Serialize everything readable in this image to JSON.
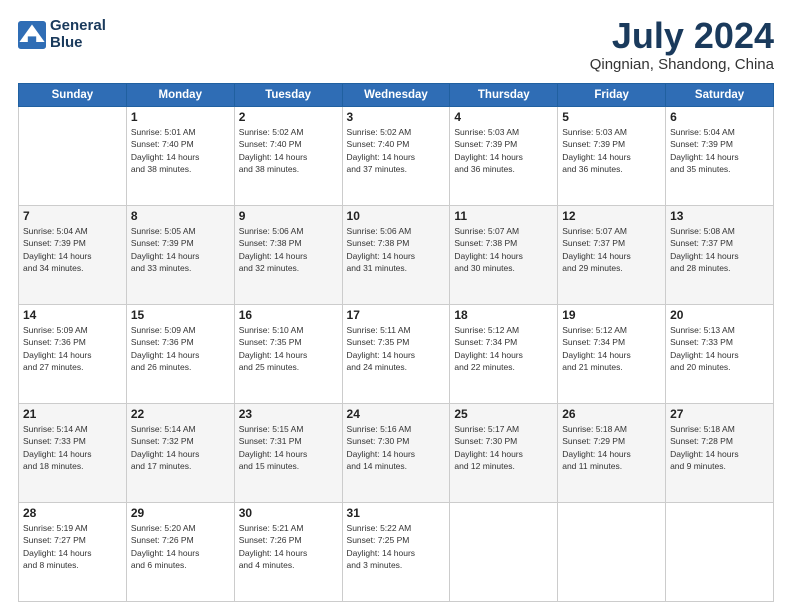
{
  "header": {
    "logo_line1": "General",
    "logo_line2": "Blue",
    "month": "July 2024",
    "location": "Qingnian, Shandong, China"
  },
  "weekdays": [
    "Sunday",
    "Monday",
    "Tuesday",
    "Wednesday",
    "Thursday",
    "Friday",
    "Saturday"
  ],
  "weeks": [
    [
      {
        "day": "",
        "info": ""
      },
      {
        "day": "1",
        "info": "Sunrise: 5:01 AM\nSunset: 7:40 PM\nDaylight: 14 hours\nand 38 minutes."
      },
      {
        "day": "2",
        "info": "Sunrise: 5:02 AM\nSunset: 7:40 PM\nDaylight: 14 hours\nand 38 minutes."
      },
      {
        "day": "3",
        "info": "Sunrise: 5:02 AM\nSunset: 7:40 PM\nDaylight: 14 hours\nand 37 minutes."
      },
      {
        "day": "4",
        "info": "Sunrise: 5:03 AM\nSunset: 7:39 PM\nDaylight: 14 hours\nand 36 minutes."
      },
      {
        "day": "5",
        "info": "Sunrise: 5:03 AM\nSunset: 7:39 PM\nDaylight: 14 hours\nand 36 minutes."
      },
      {
        "day": "6",
        "info": "Sunrise: 5:04 AM\nSunset: 7:39 PM\nDaylight: 14 hours\nand 35 minutes."
      }
    ],
    [
      {
        "day": "7",
        "info": "Sunrise: 5:04 AM\nSunset: 7:39 PM\nDaylight: 14 hours\nand 34 minutes."
      },
      {
        "day": "8",
        "info": "Sunrise: 5:05 AM\nSunset: 7:39 PM\nDaylight: 14 hours\nand 33 minutes."
      },
      {
        "day": "9",
        "info": "Sunrise: 5:06 AM\nSunset: 7:38 PM\nDaylight: 14 hours\nand 32 minutes."
      },
      {
        "day": "10",
        "info": "Sunrise: 5:06 AM\nSunset: 7:38 PM\nDaylight: 14 hours\nand 31 minutes."
      },
      {
        "day": "11",
        "info": "Sunrise: 5:07 AM\nSunset: 7:38 PM\nDaylight: 14 hours\nand 30 minutes."
      },
      {
        "day": "12",
        "info": "Sunrise: 5:07 AM\nSunset: 7:37 PM\nDaylight: 14 hours\nand 29 minutes."
      },
      {
        "day": "13",
        "info": "Sunrise: 5:08 AM\nSunset: 7:37 PM\nDaylight: 14 hours\nand 28 minutes."
      }
    ],
    [
      {
        "day": "14",
        "info": "Sunrise: 5:09 AM\nSunset: 7:36 PM\nDaylight: 14 hours\nand 27 minutes."
      },
      {
        "day": "15",
        "info": "Sunrise: 5:09 AM\nSunset: 7:36 PM\nDaylight: 14 hours\nand 26 minutes."
      },
      {
        "day": "16",
        "info": "Sunrise: 5:10 AM\nSunset: 7:35 PM\nDaylight: 14 hours\nand 25 minutes."
      },
      {
        "day": "17",
        "info": "Sunrise: 5:11 AM\nSunset: 7:35 PM\nDaylight: 14 hours\nand 24 minutes."
      },
      {
        "day": "18",
        "info": "Sunrise: 5:12 AM\nSunset: 7:34 PM\nDaylight: 14 hours\nand 22 minutes."
      },
      {
        "day": "19",
        "info": "Sunrise: 5:12 AM\nSunset: 7:34 PM\nDaylight: 14 hours\nand 21 minutes."
      },
      {
        "day": "20",
        "info": "Sunrise: 5:13 AM\nSunset: 7:33 PM\nDaylight: 14 hours\nand 20 minutes."
      }
    ],
    [
      {
        "day": "21",
        "info": "Sunrise: 5:14 AM\nSunset: 7:33 PM\nDaylight: 14 hours\nand 18 minutes."
      },
      {
        "day": "22",
        "info": "Sunrise: 5:14 AM\nSunset: 7:32 PM\nDaylight: 14 hours\nand 17 minutes."
      },
      {
        "day": "23",
        "info": "Sunrise: 5:15 AM\nSunset: 7:31 PM\nDaylight: 14 hours\nand 15 minutes."
      },
      {
        "day": "24",
        "info": "Sunrise: 5:16 AM\nSunset: 7:30 PM\nDaylight: 14 hours\nand 14 minutes."
      },
      {
        "day": "25",
        "info": "Sunrise: 5:17 AM\nSunset: 7:30 PM\nDaylight: 14 hours\nand 12 minutes."
      },
      {
        "day": "26",
        "info": "Sunrise: 5:18 AM\nSunset: 7:29 PM\nDaylight: 14 hours\nand 11 minutes."
      },
      {
        "day": "27",
        "info": "Sunrise: 5:18 AM\nSunset: 7:28 PM\nDaylight: 14 hours\nand 9 minutes."
      }
    ],
    [
      {
        "day": "28",
        "info": "Sunrise: 5:19 AM\nSunset: 7:27 PM\nDaylight: 14 hours\nand 8 minutes."
      },
      {
        "day": "29",
        "info": "Sunrise: 5:20 AM\nSunset: 7:26 PM\nDaylight: 14 hours\nand 6 minutes."
      },
      {
        "day": "30",
        "info": "Sunrise: 5:21 AM\nSunset: 7:26 PM\nDaylight: 14 hours\nand 4 minutes."
      },
      {
        "day": "31",
        "info": "Sunrise: 5:22 AM\nSunset: 7:25 PM\nDaylight: 14 hours\nand 3 minutes."
      },
      {
        "day": "",
        "info": ""
      },
      {
        "day": "",
        "info": ""
      },
      {
        "day": "",
        "info": ""
      }
    ]
  ]
}
